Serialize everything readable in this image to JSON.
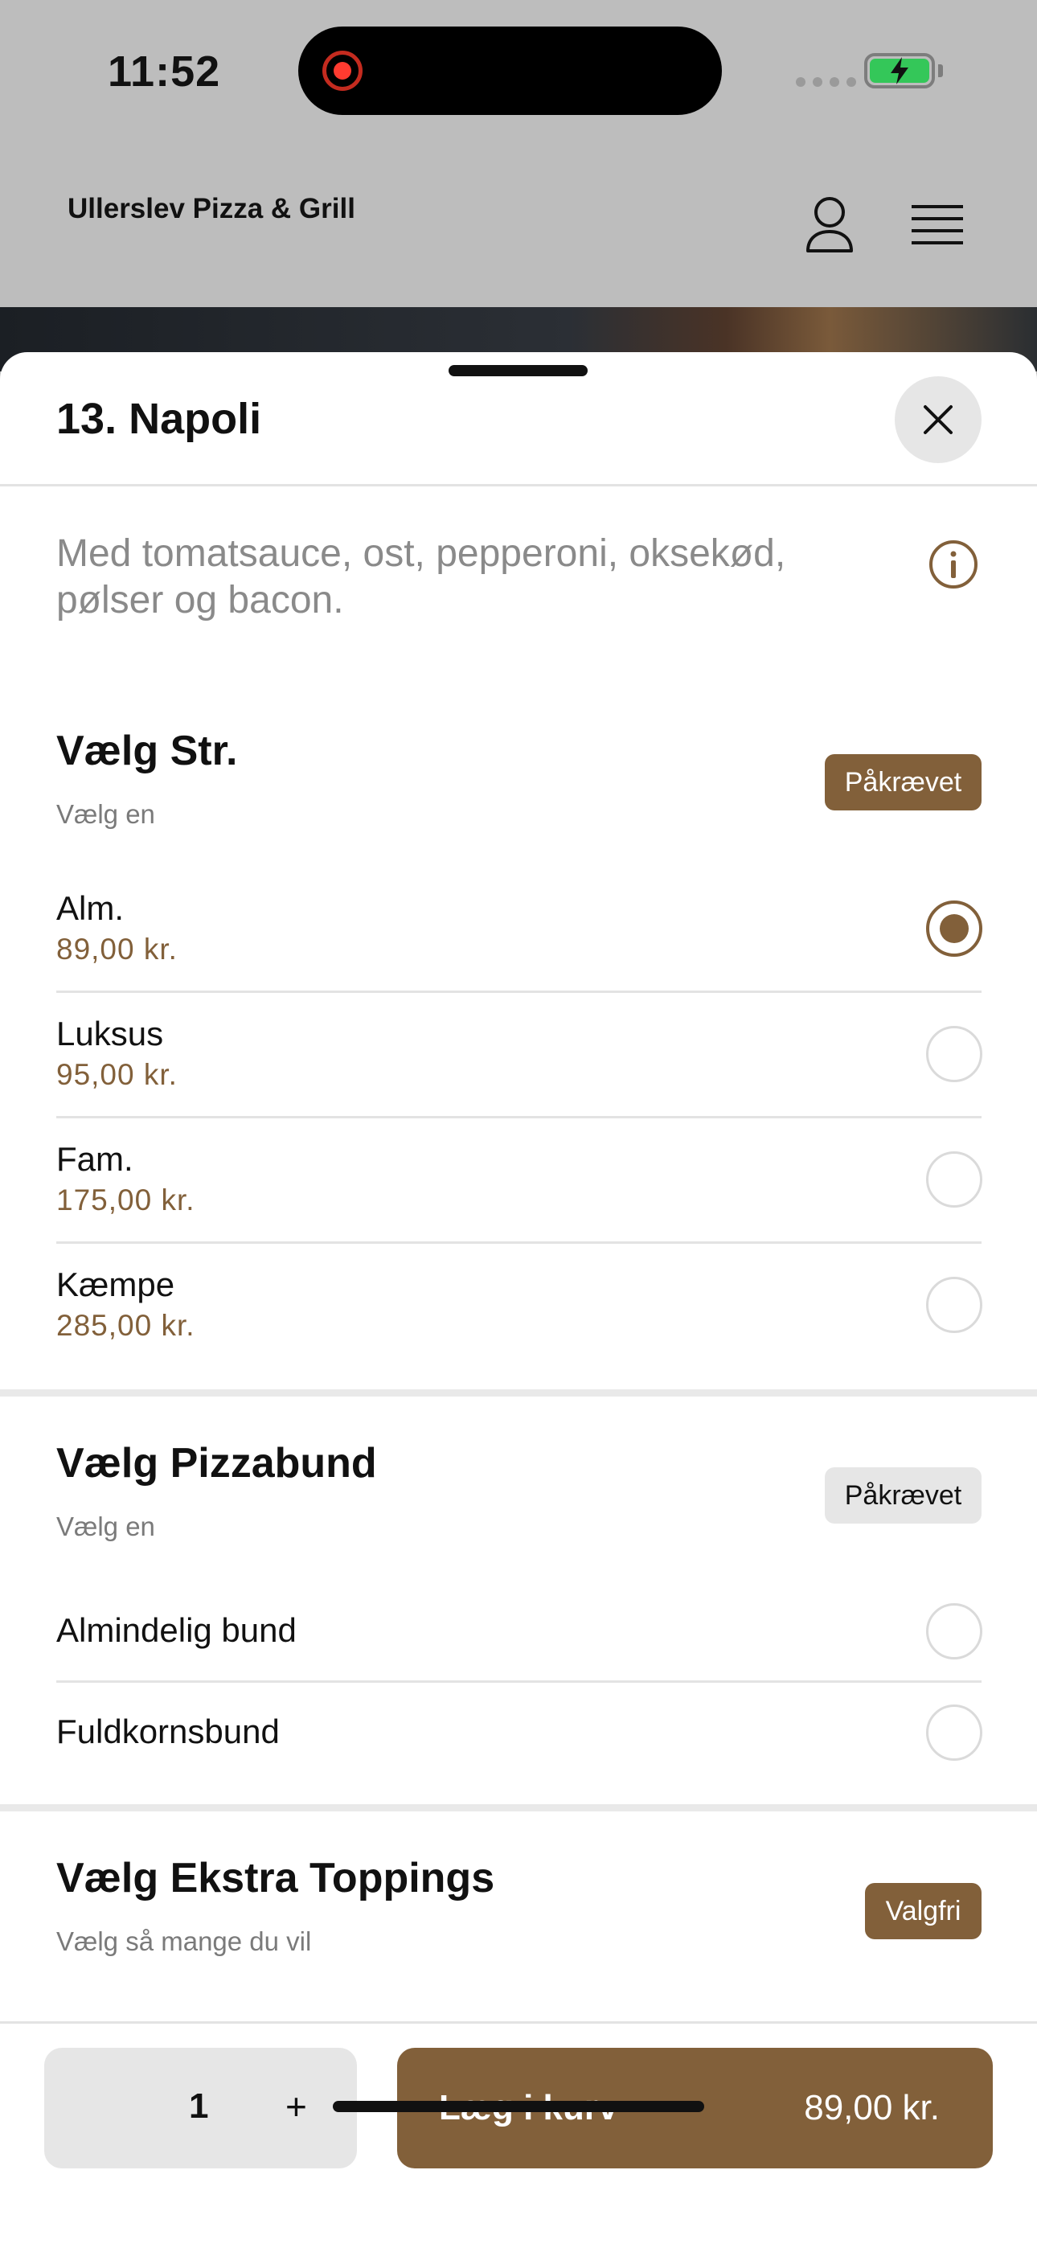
{
  "status_bar": {
    "time": "11:52"
  },
  "header": {
    "app_title": "Ullerslev Pizza & Grill"
  },
  "item": {
    "title": "13. Napoli",
    "description": "Med tomatsauce, ost, pepperoni, oksekød, pølser og bacon."
  },
  "groups": [
    {
      "title": "Vælg Str.",
      "subtitle": "Vælg en",
      "badge": "Påkrævet",
      "options": [
        {
          "name": "Alm.",
          "price": "89,00 kr.",
          "selected": true
        },
        {
          "name": "Luksus",
          "price": "95,00 kr.",
          "selected": false
        },
        {
          "name": "Fam.",
          "price": "175,00 kr.",
          "selected": false
        },
        {
          "name": "Kæmpe",
          "price": "285,00 kr.",
          "selected": false
        }
      ]
    },
    {
      "title": "Vælg Pizzabund",
      "subtitle": "Vælg en",
      "badge": "Påkrævet",
      "options": [
        {
          "name": "Almindelig bund",
          "selected": false
        },
        {
          "name": "Fuldkornsbund",
          "selected": false
        }
      ]
    },
    {
      "title": "Vælg Ekstra Toppings",
      "subtitle": "Vælg så mange du vil",
      "badge": "Valgfri"
    }
  ],
  "cart": {
    "quantity": "1",
    "plus": "+",
    "add_label": "Læg i kurv",
    "total": "89,00 kr."
  },
  "colors": {
    "accent": "#82603a",
    "battery": "#34c759",
    "record": "#ff3b30"
  },
  "icons": [
    "user-icon",
    "menu-icon",
    "close-icon",
    "info-icon",
    "battery-icon",
    "record-icon"
  ]
}
